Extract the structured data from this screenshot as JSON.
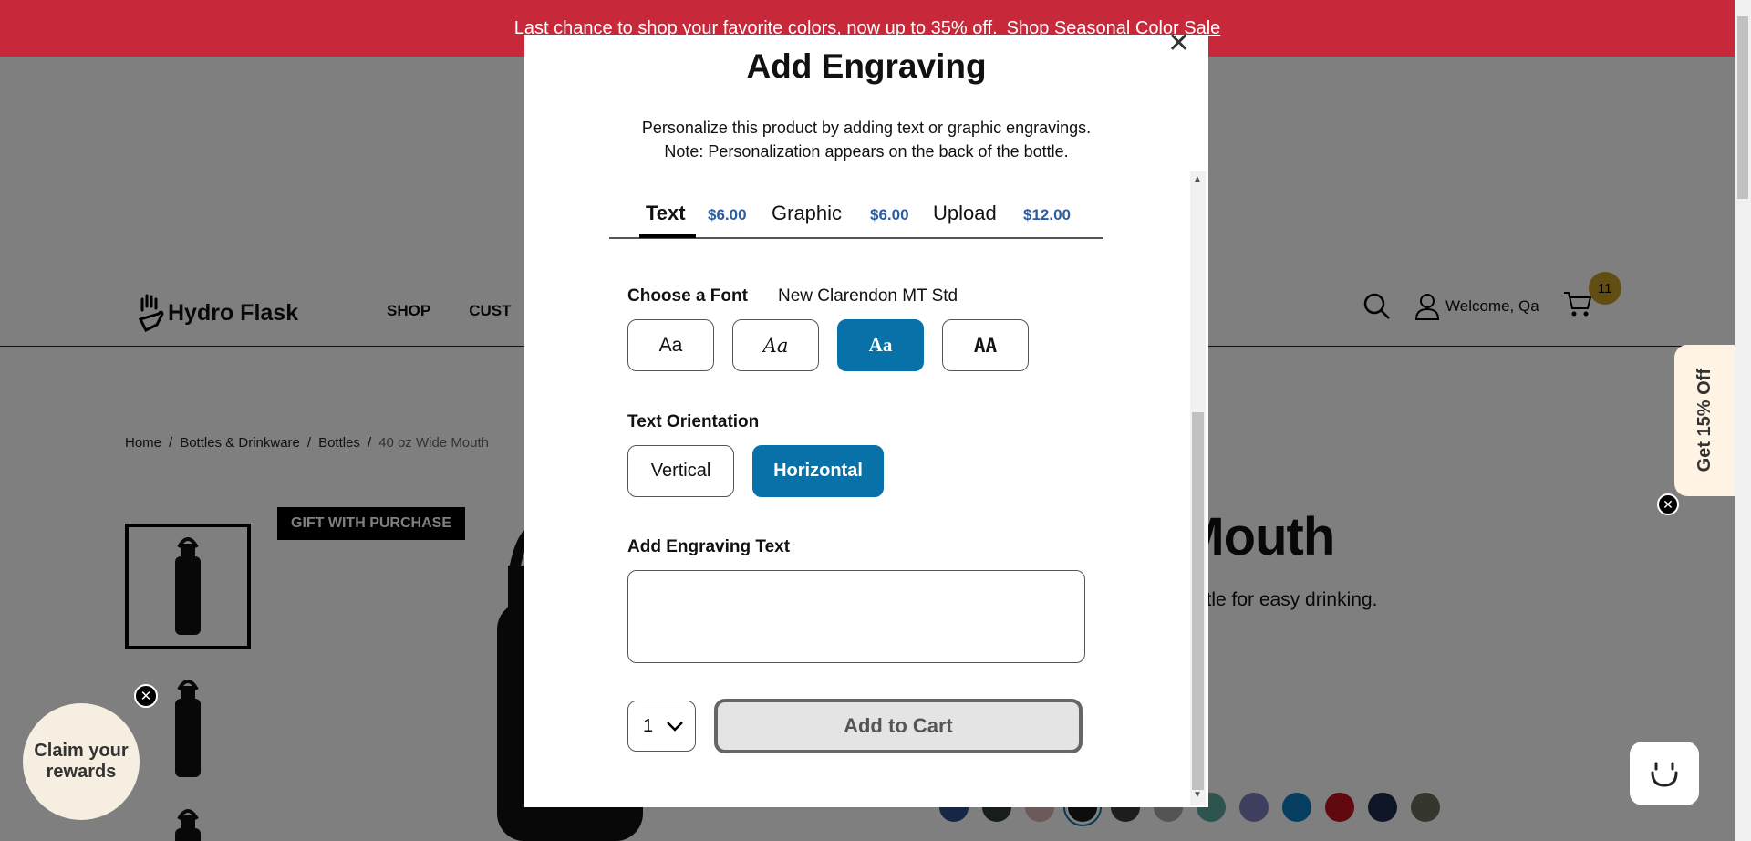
{
  "promo": {
    "text": "Last chance to shop your favorite colors, now up to 35% off.",
    "link": "Shop Seasonal Color Sale"
  },
  "header": {
    "logo": "Hydro Flask",
    "nav": [
      "SHOP",
      "CUST"
    ],
    "welcome": "Welcome, Qa",
    "cart_count": "11"
  },
  "breadcrumb": [
    "Home",
    "Bottles & Drinkware",
    "Bottles",
    "40 oz Wide Mouth"
  ],
  "product": {
    "badge": "GIFT WITH PURCHASE",
    "title_fragment": "e Mouth",
    "desc_fragment": "ottle for easy drinking.",
    "swatches": [
      "#2b4c8c",
      "#2f3a33",
      "#d9b2b5",
      "#1b1b1b",
      "#3a3a3a",
      "#a9a9a9",
      "#5aa89e",
      "#7d7fbf",
      "#0b7cc1",
      "#c1121f",
      "#1f2d4a",
      "#6b6f5f"
    ]
  },
  "side_tab": {
    "label": "Get 15% Off"
  },
  "rewards": {
    "label": "Claim your rewards"
  },
  "modal": {
    "title": "Add Engraving",
    "desc_line1": "Personalize this product by adding text or graphic engravings.",
    "desc_line2": "Note: Personalization appears on the back of the bottle.",
    "tabs": [
      {
        "label": "Text",
        "price": "$6.00"
      },
      {
        "label": "Graphic",
        "price": "$6.00"
      },
      {
        "label": "Upload",
        "price": "$12.00"
      }
    ],
    "font_label": "Choose a Font",
    "font_selected": "New Clarendon MT Std",
    "font_options": [
      "Aa",
      "Aa",
      "Aa",
      "AA"
    ],
    "orientation_label": "Text Orientation",
    "orientations": [
      "Vertical",
      "Horizontal"
    ],
    "engraving_label": "Add Engraving Text",
    "engraving_value": "",
    "qty": "1",
    "add_to_cart": "Add to Cart"
  },
  "colors": {
    "promo_bg": "#c8293a",
    "accent": "#0872a8",
    "price": "#2d5d9f"
  }
}
